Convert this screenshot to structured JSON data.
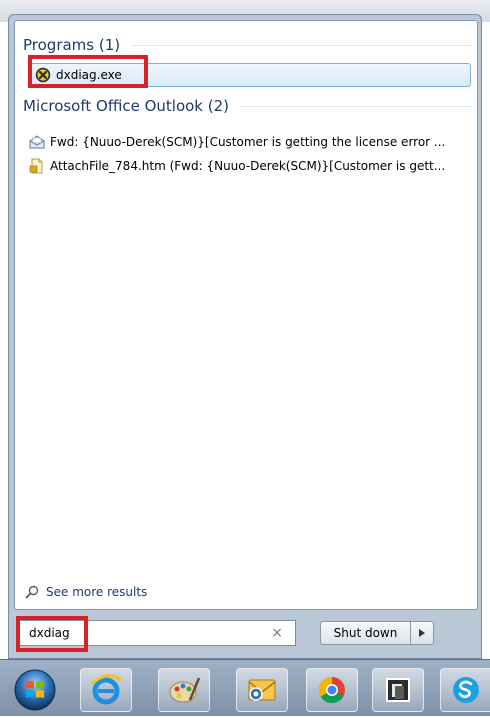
{
  "start_menu": {
    "groups": [
      {
        "title": "Programs (1)",
        "items": [
          {
            "label": "dxdiag.exe",
            "icon": "dxdiag-icon"
          }
        ]
      },
      {
        "title": "Microsoft Office Outlook (2)",
        "items": [
          {
            "label": "Fwd: {Nuuo-Derek(SCM)}[Customer is getting the license error ...",
            "icon": "envelope-icon"
          },
          {
            "label": "AttachFile_784.htm (Fwd: {Nuuo-Derek(SCM)}[Customer is gett...",
            "icon": "document-icon"
          }
        ]
      }
    ],
    "see_more": "See more results",
    "search": {
      "value": "dxdiag"
    },
    "shutdown_label": "Shut down"
  },
  "taskbar": {
    "items": [
      "start-orb-icon",
      "internet-explorer-icon",
      "paint-icon",
      "outlook-icon",
      "chrome-icon",
      "app-window-icon",
      "skype-icon"
    ]
  },
  "colors": {
    "highlight_box": "#d8222a",
    "group_header": "#1e3a6e",
    "selected_item_border": "#84acd9"
  }
}
